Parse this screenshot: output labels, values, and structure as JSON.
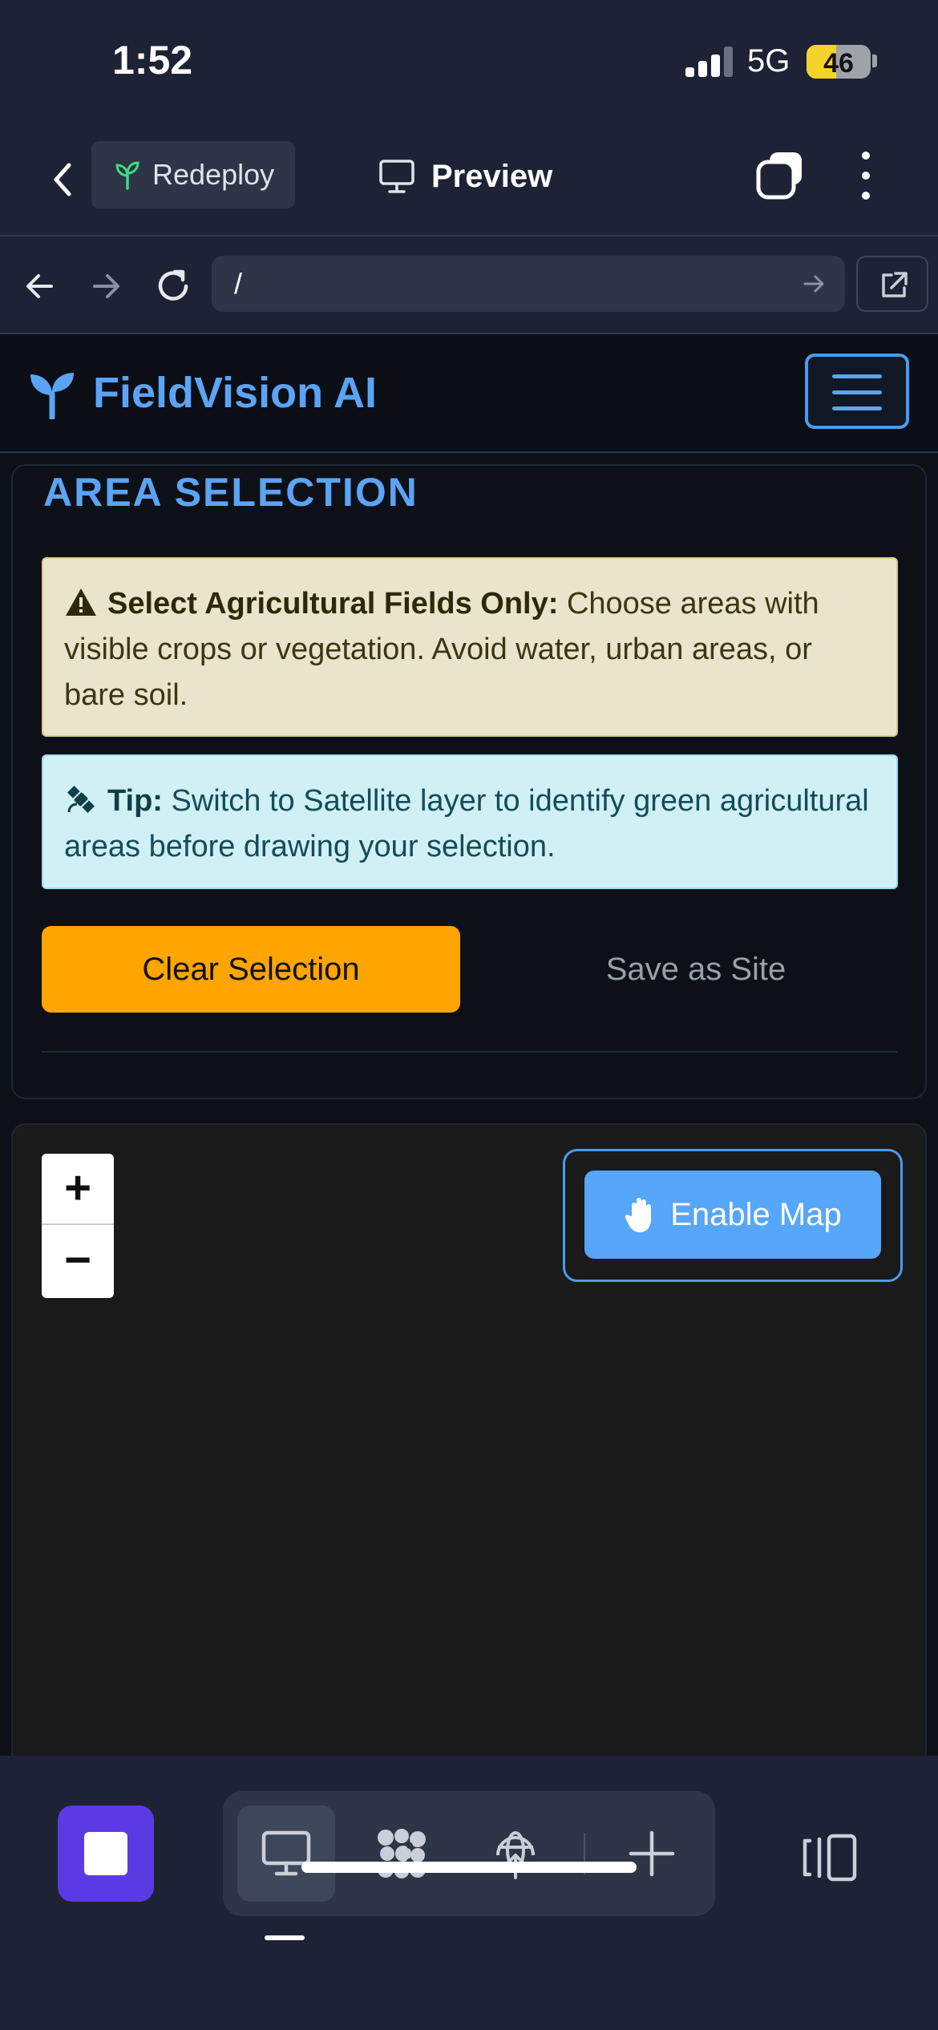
{
  "status": {
    "time": "1:52",
    "network": "5G",
    "battery": "46",
    "battery_level": 0.46
  },
  "toolbar": {
    "redeploy_label": "Redeploy",
    "preview_label": "Preview"
  },
  "urlbar": {
    "url": "/"
  },
  "app": {
    "brand": "FieldVision AI"
  },
  "area_selection": {
    "title": "AREA SELECTION",
    "warning_title": "Select Agricultural Fields Only:",
    "warning_text": " Choose areas with visible crops or vegetation. Avoid water, urban areas, or bare soil.",
    "tip_title": "Tip:",
    "tip_text": " Switch to Satellite layer to identify green agricultural areas before drawing your selection.",
    "clear_button": "Clear Selection",
    "save_button": "Save as Site"
  },
  "map": {
    "zoom_in": "+",
    "zoom_out": "−",
    "enable_button": "Enable Map"
  },
  "colors": {
    "accent": "#5ba4f5",
    "warning_bg": "#ebe4cc",
    "tip_bg": "#d0f0f6",
    "clear_button": "#fea502",
    "stop_button": "#5b3ae4",
    "map_bg": "#1a1a1a"
  },
  "icons": {
    "back": "chevron-left-icon",
    "redeploy": "sprout-icon",
    "preview": "monitor-icon",
    "tabs": "tabs-icon",
    "more": "more-vertical-icon",
    "brand": "seedling-icon",
    "warning": "warning-triangle-icon",
    "tip": "satellite-icon",
    "enable_map": "hand-icon"
  }
}
